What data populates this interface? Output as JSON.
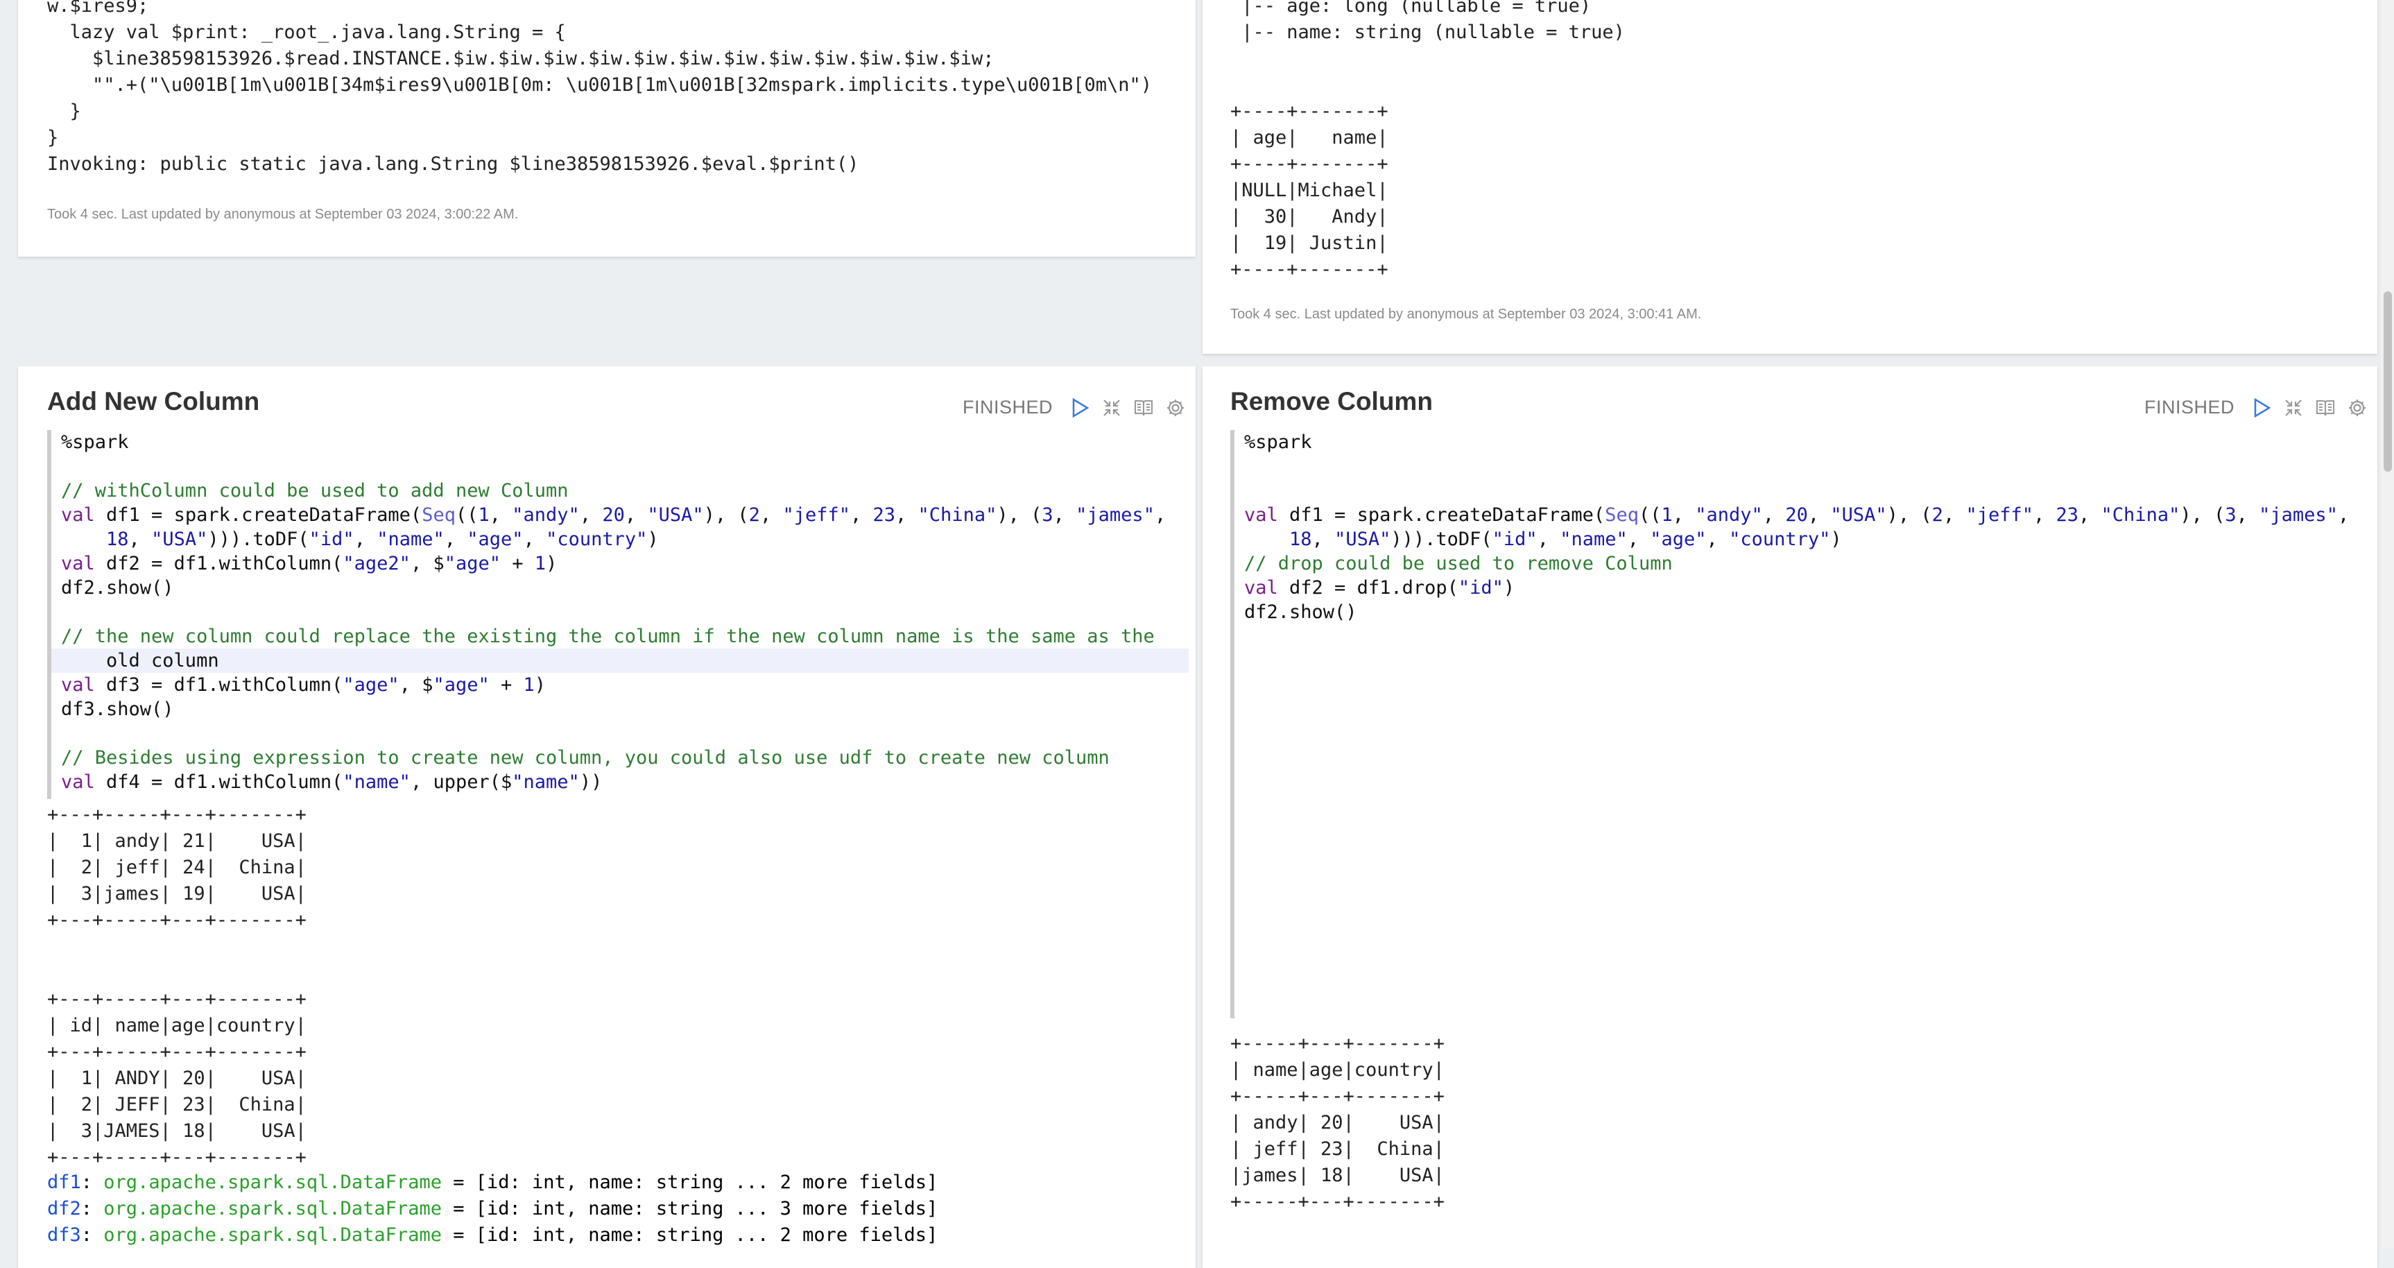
{
  "top_left": {
    "output_lines": [
      "w.$ires9;",
      "  lazy val $print: _root_.java.lang.String = {",
      "    $line38598153926.$read.INSTANCE.$iw.$iw.$iw.$iw.$iw.$iw.$iw.$iw.$iw.$iw.$iw.$iw;",
      "    \"\".+(\"\\u001B[1m\\u001B[34m$ires9\\u001B[0m: \\u001B[1m\\u001B[32mspark.implicits.type\\u001B[0m\\n\")",
      "  }",
      "}",
      "Invoking: public static java.lang.String $line38598153926.$eval.$print()"
    ],
    "meta": "Took 4 sec. Last updated by anonymous at September 03 2024, 3:00:22 AM."
  },
  "top_right": {
    "output_lines": [
      " |-- age: long (nullable = true)",
      " |-- name: string (nullable = true)",
      "",
      "",
      "+----+-------+",
      "| age|   name|",
      "+----+-------+",
      "|NULL|Michael|",
      "|  30|   Andy|",
      "|  19| Justin|",
      "+----+-------+"
    ],
    "meta": "Took 4 sec. Last updated by anonymous at September 03 2024, 3:00:41 AM."
  },
  "add_column": {
    "title": "Add New Column",
    "status": "FINISHED",
    "code": [
      "%spark",
      "",
      "// withColumn could be used to add new Column",
      "val df1 = spark.createDataFrame(Seq((1, \"andy\", 20, \"USA\"), (2, \"jeff\", 23, \"China\"), (3, \"james\",",
      "    18, \"USA\"))).toDF(\"id\", \"name\", \"age\", \"country\")",
      "val df2 = df1.withColumn(\"age2\", $\"age\" + 1)",
      "df2.show()",
      "",
      "// the new column could replace the existing the column if the new column name is the same as the",
      "    old column",
      "val df3 = df1.withColumn(\"age\", $\"age\" + 1)",
      "df3.show()",
      "",
      "// Besides using expression to create new column, you could also use udf to create new column",
      "val df4 = df1.withColumn(\"name\", upper($\"name\"))"
    ],
    "output_lines": [
      "+---+-----+---+-------+",
      "|  1| andy| 21|    USA|",
      "|  2| jeff| 24|  China|",
      "|  3|james| 19|    USA|",
      "+---+-----+---+-------+",
      "",
      "",
      "+---+-----+---+-------+",
      "| id| name|age|country|",
      "+---+-----+---+-------+",
      "|  1| ANDY| 20|    USA|",
      "|  2| JEFF| 23|  China|",
      "|  3|JAMES| 18|    USA|",
      "+---+-----+---+-------+"
    ],
    "df_lines": [
      {
        "var": "df1",
        "type": "org.apache.spark.sql.DataFrame",
        "rest": " = [id: int, name: string ... 2 more fields]"
      },
      {
        "var": "df2",
        "type": "org.apache.spark.sql.DataFrame",
        "rest": " = [id: int, name: string ... 3 more fields]"
      },
      {
        "var": "df3",
        "type": "org.apache.spark.sql.DataFrame",
        "rest": " = [id: int, name: string ... 2 more fields]"
      }
    ]
  },
  "remove_column": {
    "title": "Remove Column",
    "status": "FINISHED",
    "code": [
      "%spark",
      "",
      "",
      "val df1 = spark.createDataFrame(Seq((1, \"andy\", 20, \"USA\"), (2, \"jeff\", 23, \"China\"), (3, \"james\",",
      "    18, \"USA\"))).toDF(\"id\", \"name\", \"age\", \"country\")",
      "// drop could be used to remove Column",
      "val df2 = df1.drop(\"id\")",
      "df2.show()"
    ],
    "output_lines": [
      "+-----+---+-------+",
      "| name|age|country|",
      "+-----+---+-------+",
      "| andy| 20|    USA|",
      "| jeff| 23|  China|",
      "|james| 18|    USA|",
      "+-----+---+-------+"
    ]
  },
  "icons": [
    "run-icon",
    "collapse-icon",
    "book-icon",
    "gear-icon"
  ],
  "colors": {
    "comment": "#2e7d32",
    "keyword": "#7a1f8c",
    "string": "#1a1aa6",
    "type": "#2ca02c",
    "variable": "#1a4fd0"
  }
}
